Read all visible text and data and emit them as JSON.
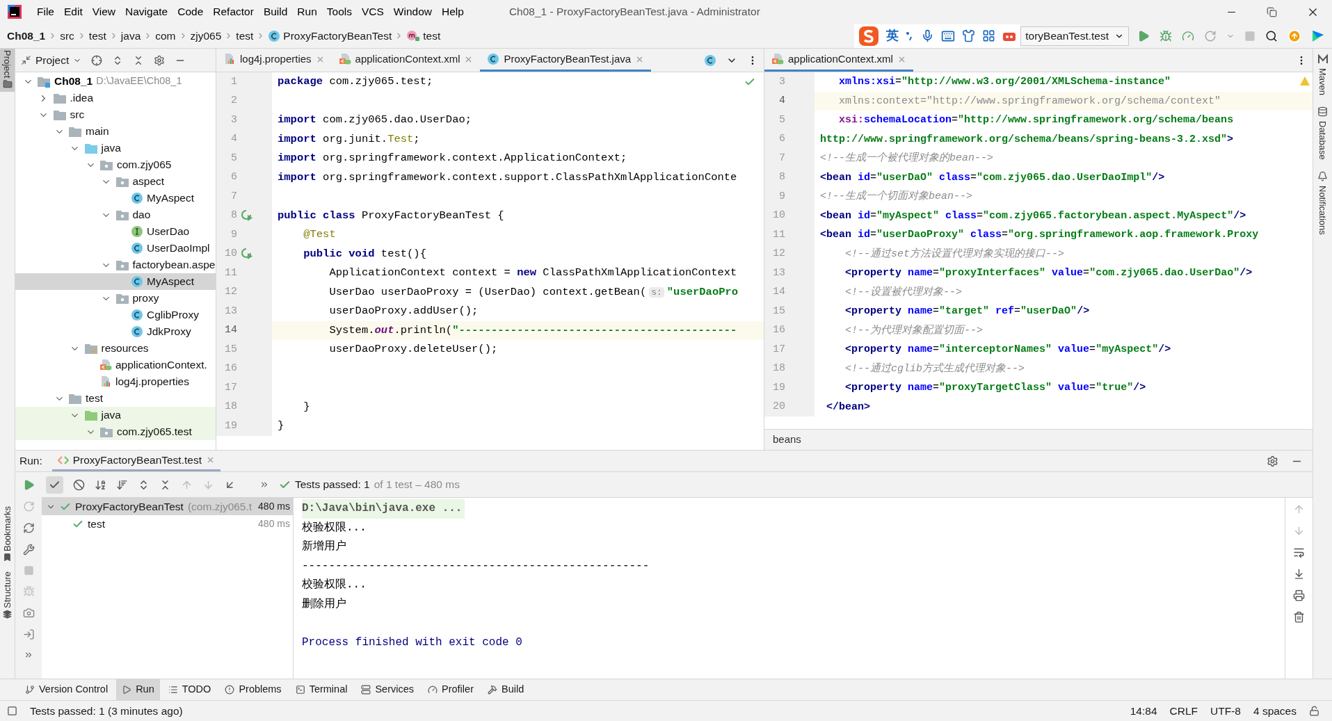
{
  "window": {
    "title": "Ch08_1 - ProxyFactoryBeanTest.java - Administrator"
  },
  "menu": [
    "File",
    "Edit",
    "View",
    "Navigate",
    "Code",
    "Refactor",
    "Build",
    "Run",
    "Tools",
    "VCS",
    "Window",
    "Help"
  ],
  "breadcrumbs": [
    {
      "label": "Ch08_1",
      "kind": "project"
    },
    {
      "label": "src",
      "kind": "plain"
    },
    {
      "label": "test",
      "kind": "plain"
    },
    {
      "label": "java",
      "kind": "plain"
    },
    {
      "label": "com",
      "kind": "plain"
    },
    {
      "label": "zjy065",
      "kind": "plain"
    },
    {
      "label": "test",
      "kind": "plain"
    },
    {
      "label": "ProxyFactoryBeanTest",
      "kind": "class"
    },
    {
      "label": "test",
      "kind": "method"
    }
  ],
  "ime": {
    "label": "英"
  },
  "run_config": {
    "label": "toryBeanTest.test"
  },
  "left_sidebar": {
    "top": [
      {
        "label": "Project",
        "selected": true
      }
    ],
    "bottom": [
      {
        "label": "Bookmarks"
      },
      {
        "label": "Structure"
      }
    ]
  },
  "right_sidebar": [
    {
      "label": "Maven",
      "kind": "maven"
    },
    {
      "label": "Database",
      "kind": "database"
    },
    {
      "label": "Notifications",
      "kind": "bell"
    }
  ],
  "project_panel": {
    "title": "Project",
    "tree": [
      {
        "label": "Ch08_1",
        "hint": "D:\\JavaEE\\Ch08_1",
        "kind": "project",
        "expanded": true,
        "selected": false,
        "children": [
          {
            "label": ".idea",
            "kind": "folder",
            "expanded": false,
            "selected": false
          },
          {
            "label": "src",
            "kind": "folder",
            "expanded": true,
            "selected": false,
            "children": [
              {
                "label": "main",
                "kind": "folder",
                "expanded": true,
                "selected": false,
                "children": [
                  {
                    "label": "java",
                    "kind": "source",
                    "expanded": true,
                    "selected": false,
                    "children": [
                      {
                        "label": "com.zjy065",
                        "kind": "package",
                        "expanded": true,
                        "selected": false,
                        "children": [
                          {
                            "label": "aspect",
                            "kind": "package",
                            "expanded": true,
                            "selected": false,
                            "children": [
                              {
                                "label": "MyAspect",
                                "kind": "class",
                                "selected": false
                              }
                            ]
                          },
                          {
                            "label": "dao",
                            "kind": "package",
                            "expanded": true,
                            "selected": false,
                            "children": [
                              {
                                "label": "UserDao",
                                "kind": "interface",
                                "selected": false
                              },
                              {
                                "label": "UserDaoImpl",
                                "kind": "class",
                                "selected": false
                              }
                            ]
                          },
                          {
                            "label": "factorybean.aspe",
                            "kind": "package",
                            "expanded": true,
                            "selected": false,
                            "children": [
                              {
                                "label": "MyAspect",
                                "kind": "class",
                                "selected": true
                              }
                            ]
                          },
                          {
                            "label": "proxy",
                            "kind": "package",
                            "expanded": true,
                            "selected": false,
                            "children": [
                              {
                                "label": "CglibProxy",
                                "kind": "class",
                                "selected": false
                              },
                              {
                                "label": "JdkProxy",
                                "kind": "class",
                                "selected": false
                              }
                            ]
                          }
                        ]
                      }
                    ]
                  },
                  {
                    "label": "resources",
                    "kind": "resources",
                    "expanded": true,
                    "selected": false,
                    "children": [
                      {
                        "label": "applicationContext.",
                        "kind": "xml",
                        "selected": false
                      },
                      {
                        "label": "log4j.properties",
                        "kind": "properties",
                        "selected": false
                      }
                    ]
                  }
                ]
              },
              {
                "label": "test",
                "kind": "folder",
                "expanded": true,
                "selected": false,
                "children": [
                  {
                    "label": "java",
                    "kind": "test",
                    "expanded": true,
                    "selected": false,
                    "children": [
                      {
                        "label": "com.zjy065.test",
                        "kind": "test-package",
                        "expanded": true,
                        "selected": false
                      }
                    ]
                  }
                ]
              }
            ]
          }
        ]
      }
    ]
  },
  "left_editor": {
    "tabs": [
      {
        "label": "log4j.properties",
        "kind": "properties",
        "selected": false
      },
      {
        "label": "applicationContext.xml",
        "kind": "xml",
        "selected": false
      },
      {
        "label": "ProxyFactoryBeanTest.java",
        "kind": "class",
        "selected": true
      }
    ],
    "lines": [
      {
        "num": "1",
        "current": false,
        "run_icon": false,
        "segments": [
          {
            "kind": "kw",
            "text": "package"
          },
          {
            "kind": "plain",
            "text": " com.zjy065.test;"
          }
        ]
      },
      {
        "num": "2",
        "current": false,
        "run_icon": false
      },
      {
        "num": "3",
        "current": false,
        "run_icon": false,
        "segments": [
          {
            "kind": "kw",
            "text": "import"
          },
          {
            "kind": "plain",
            "text": " com.zjy065.dao.UserDao;"
          }
        ]
      },
      {
        "num": "4",
        "current": false,
        "run_icon": false,
        "segments": [
          {
            "kind": "kw",
            "text": "import"
          },
          {
            "kind": "plain",
            "text": " org.junit."
          },
          {
            "kind": "ann",
            "text": "Test"
          },
          {
            "kind": "plain",
            "text": ";"
          }
        ]
      },
      {
        "num": "5",
        "current": false,
        "run_icon": false,
        "segments": [
          {
            "kind": "kw",
            "text": "import"
          },
          {
            "kind": "plain",
            "text": " org.springframework.context.ApplicationContext;"
          }
        ]
      },
      {
        "num": "6",
        "current": false,
        "run_icon": false,
        "segments": [
          {
            "kind": "kw",
            "text": "import"
          },
          {
            "kind": "plain",
            "text": " org.springframework.context.support.ClassPathXmlApplicationConte"
          }
        ]
      },
      {
        "num": "7",
        "current": false,
        "run_icon": false
      },
      {
        "num": "8",
        "current": false,
        "run_icon": true,
        "segments": [
          {
            "kind": "kw",
            "text": "public class"
          },
          {
            "kind": "plain",
            "text": " ProxyFactoryBeanTest {"
          }
        ]
      },
      {
        "num": "9",
        "current": false,
        "run_icon": false,
        "segments": [
          {
            "kind": "ann",
            "text": "    @Test"
          }
        ]
      },
      {
        "num": "10",
        "current": false,
        "run_icon": true,
        "segments": [
          {
            "kind": "kw",
            "text": "    public void"
          },
          {
            "kind": "plain",
            "text": " test(){"
          }
        ]
      },
      {
        "num": "11",
        "current": false,
        "run_icon": false,
        "segments": [
          {
            "kind": "plain",
            "text": "        ApplicationContext context = "
          },
          {
            "kind": "kw",
            "text": "new"
          },
          {
            "kind": "plain",
            "text": " ClassPathXmlApplicationContext"
          }
        ]
      },
      {
        "num": "12",
        "current": false,
        "run_icon": false,
        "segments": [
          {
            "kind": "plain",
            "text": "        UserDao userDaoProxy = (UserDao) context.getBean("
          },
          {
            "kind": "hint",
            "text": "s:"
          },
          {
            "kind": "str",
            "text": "\"userDaoPro"
          }
        ]
      },
      {
        "num": "13",
        "current": false,
        "run_icon": false,
        "segments": [
          {
            "kind": "plain",
            "text": "        userDaoProxy.addUser();"
          }
        ]
      },
      {
        "num": "14",
        "current": true,
        "run_icon": false,
        "segments": [
          {
            "kind": "plain",
            "text": "        System."
          },
          {
            "kind": "static",
            "text": "out"
          },
          {
            "kind": "plain",
            "text": ".println("
          },
          {
            "kind": "str",
            "text": "\"-------------------------------------------"
          }
        ]
      },
      {
        "num": "15",
        "current": false,
        "run_icon": false,
        "segments": [
          {
            "kind": "plain",
            "text": "        userDaoProxy.deleteUser();"
          }
        ]
      },
      {
        "num": "16",
        "current": false,
        "run_icon": false
      },
      {
        "num": "17",
        "current": false,
        "run_icon": false
      },
      {
        "num": "18",
        "current": false,
        "run_icon": false,
        "segments": [
          {
            "kind": "plain",
            "text": "    }"
          }
        ]
      },
      {
        "num": "19",
        "current": false,
        "run_icon": false,
        "segments": [
          {
            "kind": "plain",
            "text": "}"
          }
        ]
      }
    ]
  },
  "right_editor": {
    "tabs": [
      {
        "label": "applicationContext.xml",
        "kind": "xml",
        "selected": true
      }
    ],
    "breadcrumb": "beans",
    "lines": [
      {
        "num": "3",
        "current": false,
        "segments": [
          {
            "kind": "attr",
            "text": "   xmlns:xsi"
          },
          {
            "kind": "plain",
            "text": "="
          },
          {
            "kind": "val",
            "text": "\"http://www.w3.org/2001/XMLSchema-instance\""
          }
        ]
      },
      {
        "num": "4",
        "current": true,
        "segments": [
          {
            "kind": "unused",
            "text": "   xmlns:context=\"http://www.springframework.org/schema/context\""
          }
        ]
      },
      {
        "num": "5",
        "current": false,
        "segments": [
          {
            "kind": "ns",
            "text": "   xsi:"
          },
          {
            "kind": "attr",
            "text": "schemaLocation"
          },
          {
            "kind": "plain",
            "text": "="
          },
          {
            "kind": "val",
            "text": "\"http://www.springframework.org/schema/beans"
          }
        ]
      },
      {
        "num": "6",
        "current": false,
        "segments": [
          {
            "kind": "val",
            "text": "http://www.springframework.org/schema/beans/spring-beans-3.2.xsd\""
          },
          {
            "kind": "tag",
            "text": ">"
          }
        ]
      },
      {
        "num": "7",
        "current": false,
        "segments": [
          {
            "kind": "comment",
            "text": "<!--生成一个被代理对象的bean-->"
          }
        ]
      },
      {
        "num": "8",
        "current": false,
        "segments": [
          {
            "kind": "tag",
            "text": "<bean"
          },
          {
            "kind": "attr",
            "text": " id"
          },
          {
            "kind": "plain",
            "text": "="
          },
          {
            "kind": "val",
            "text": "\"userDaO\""
          },
          {
            "kind": "attr",
            "text": " class"
          },
          {
            "kind": "plain",
            "text": "="
          },
          {
            "kind": "val",
            "text": "\"com.zjy065.dao.UserDaoImpl\""
          },
          {
            "kind": "tag",
            "text": "/>"
          }
        ]
      },
      {
        "num": "9",
        "current": false,
        "segments": [
          {
            "kind": "comment",
            "text": "<!--生成一个切面对象bean-->"
          }
        ]
      },
      {
        "num": "10",
        "current": false,
        "segments": [
          {
            "kind": "tag",
            "text": "<bean"
          },
          {
            "kind": "attr",
            "text": " id"
          },
          {
            "kind": "plain",
            "text": "="
          },
          {
            "kind": "val",
            "text": "\"myAspect\""
          },
          {
            "kind": "attr",
            "text": " class"
          },
          {
            "kind": "plain",
            "text": "="
          },
          {
            "kind": "val",
            "text": "\"com.zjy065.factorybean.aspect.MyAspect\""
          },
          {
            "kind": "tag",
            "text": "/>"
          }
        ]
      },
      {
        "num": "11",
        "current": false,
        "segments": [
          {
            "kind": "tag",
            "text": "<bean"
          },
          {
            "kind": "attr",
            "text": " id"
          },
          {
            "kind": "plain",
            "text": "="
          },
          {
            "kind": "val",
            "text": "\"userDaoProxy\""
          },
          {
            "kind": "attr",
            "text": " class"
          },
          {
            "kind": "plain",
            "text": "="
          },
          {
            "kind": "val",
            "text": "\"org.springframework.aop.framework.Proxy"
          }
        ]
      },
      {
        "num": "12",
        "current": false,
        "segments": [
          {
            "kind": "comment",
            "text": "    <!--通过set方法设置代理对象实现的接口-->"
          }
        ]
      },
      {
        "num": "13",
        "current": false,
        "segments": [
          {
            "kind": "tag",
            "text": "    <property"
          },
          {
            "kind": "attr",
            "text": " name"
          },
          {
            "kind": "plain",
            "text": "="
          },
          {
            "kind": "val",
            "text": "\"proxyInterfaces\""
          },
          {
            "kind": "attr",
            "text": " value"
          },
          {
            "kind": "plain",
            "text": "="
          },
          {
            "kind": "val",
            "text": "\"com.zjy065.dao.UserDao\""
          },
          {
            "kind": "tag",
            "text": "/>"
          }
        ]
      },
      {
        "num": "14",
        "current": false,
        "segments": [
          {
            "kind": "comment",
            "text": "    <!--设置被代理对象-->"
          }
        ]
      },
      {
        "num": "15",
        "current": false,
        "segments": [
          {
            "kind": "tag",
            "text": "    <property"
          },
          {
            "kind": "attr",
            "text": " name"
          },
          {
            "kind": "plain",
            "text": "="
          },
          {
            "kind": "val",
            "text": "\"target\""
          },
          {
            "kind": "attr",
            "text": " ref"
          },
          {
            "kind": "plain",
            "text": "="
          },
          {
            "kind": "val",
            "text": "\"userDaO\""
          },
          {
            "kind": "tag",
            "text": "/>"
          }
        ]
      },
      {
        "num": "16",
        "current": false,
        "segments": [
          {
            "kind": "comment",
            "text": "    <!--为代理对象配置切面-->"
          }
        ]
      },
      {
        "num": "17",
        "current": false,
        "segments": [
          {
            "kind": "tag",
            "text": "    <property"
          },
          {
            "kind": "attr",
            "text": " name"
          },
          {
            "kind": "plain",
            "text": "="
          },
          {
            "kind": "val",
            "text": "\"interceptorNames\""
          },
          {
            "kind": "attr",
            "text": " value"
          },
          {
            "kind": "plain",
            "text": "="
          },
          {
            "kind": "val",
            "text": "\"myAspect\""
          },
          {
            "kind": "tag",
            "text": "/>"
          }
        ]
      },
      {
        "num": "18",
        "current": false,
        "segments": [
          {
            "kind": "comment",
            "text": "    <!--通过cglib方式生成代理对象-->"
          }
        ]
      },
      {
        "num": "19",
        "current": false,
        "segments": [
          {
            "kind": "tag",
            "text": "    <property"
          },
          {
            "kind": "attr",
            "text": " name"
          },
          {
            "kind": "plain",
            "text": "="
          },
          {
            "kind": "val",
            "text": "\"proxyTargetClass\""
          },
          {
            "kind": "attr",
            "text": " value"
          },
          {
            "kind": "plain",
            "text": "="
          },
          {
            "kind": "val",
            "text": "\"true\""
          },
          {
            "kind": "tag",
            "text": "/>"
          }
        ]
      },
      {
        "num": "20",
        "current": false,
        "segments": [
          {
            "kind": "tag",
            "text": " </bean>"
          }
        ]
      }
    ]
  },
  "run_panel": {
    "label": "Run:",
    "tab": "ProxyFactoryBeanTest.test",
    "show_passed": true,
    "summary": "Tests passed: 1",
    "summary_detail": "of 1 test – 480 ms",
    "tests": [
      {
        "label": "ProxyFactoryBeanTest",
        "detail": "(com.zjy065.t",
        "time": "480 ms",
        "expanded": true,
        "selected": true,
        "children": [
          {
            "label": "test",
            "time": "480 ms",
            "selected": false
          }
        ]
      }
    ],
    "console": [
      {
        "kind": "command",
        "text": "D:\\Java\\bin\\java.exe ..."
      },
      {
        "kind": "output",
        "text": "校验权限..."
      },
      {
        "kind": "output",
        "text": "新增用户"
      },
      {
        "kind": "output",
        "text": "----------------------------------------------------"
      },
      {
        "kind": "output",
        "text": "校验权限..."
      },
      {
        "kind": "output",
        "text": "删除用户"
      },
      {
        "kind": "exit",
        "text": "Process finished with exit code 0"
      }
    ]
  },
  "tool_tabs": [
    {
      "label": "Version Control",
      "kind": "vcs",
      "selected": false
    },
    {
      "label": "Run",
      "kind": "run",
      "selected": true
    },
    {
      "label": "TODO",
      "kind": "todo",
      "selected": false
    },
    {
      "label": "Problems",
      "kind": "problems",
      "selected": false
    },
    {
      "label": "Terminal",
      "kind": "terminal",
      "selected": false
    },
    {
      "label": "Services",
      "kind": "services",
      "selected": false
    },
    {
      "label": "Profiler",
      "kind": "profiler",
      "selected": false
    },
    {
      "label": "Build",
      "kind": "build",
      "selected": false
    }
  ],
  "status_bar": {
    "message": "Tests passed: 1 (3 minutes ago)",
    "items": [
      "14:84",
      "CRLF",
      "UTF-8",
      "4 spaces"
    ]
  }
}
